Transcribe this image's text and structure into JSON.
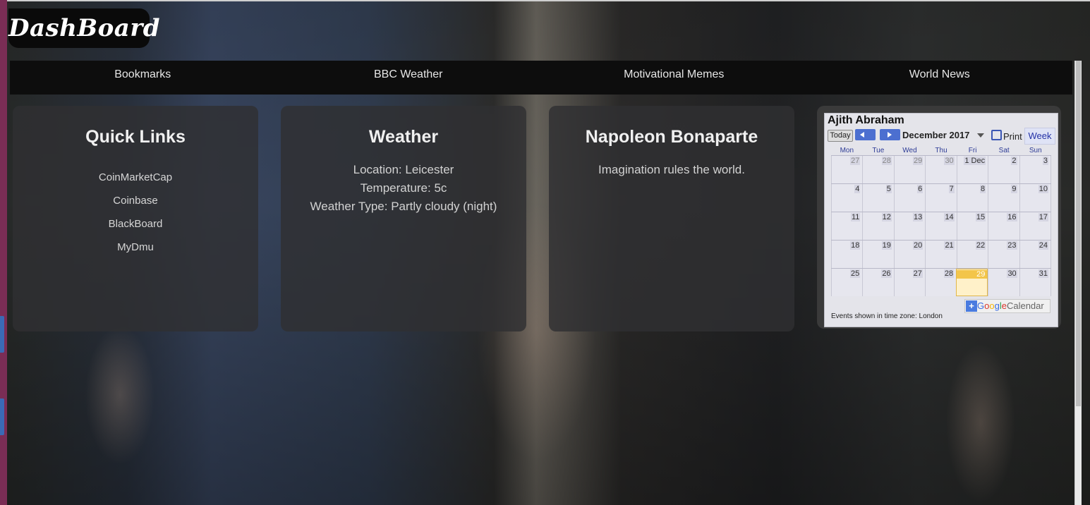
{
  "header": {
    "logo_text": "DashBoard"
  },
  "nav": {
    "items": [
      "Bookmarks",
      "BBC Weather",
      "Motivational Memes",
      "World News"
    ]
  },
  "quick_links": {
    "title": "Quick Links",
    "links": [
      "CoinMarketCap",
      "Coinbase",
      "BlackBoard",
      "MyDmu"
    ]
  },
  "weather": {
    "title": "Weather",
    "location": "Location: Leicester",
    "temperature": "Temperature: 5c",
    "type": "Weather Type: Partly cloudy (night)"
  },
  "quote": {
    "author": "Napoleon Bonaparte",
    "text": "Imagination rules the world."
  },
  "calendar": {
    "owner": "Ajith Abraham",
    "today_label": "Today",
    "month": "December 2017",
    "print_label": "Print",
    "week_label": "Week",
    "days_of_week": [
      "Mon",
      "Tue",
      "Wed",
      "Thu",
      "Fri",
      "Sat",
      "Sun"
    ],
    "weeks": [
      [
        "27",
        "28",
        "29",
        "30",
        "1 Dec",
        "2",
        "3"
      ],
      [
        "4",
        "5",
        "6",
        "7",
        "8",
        "9",
        "10"
      ],
      [
        "11",
        "12",
        "13",
        "14",
        "15",
        "16",
        "17"
      ],
      [
        "18",
        "19",
        "20",
        "21",
        "22",
        "23",
        "24"
      ],
      [
        "25",
        "26",
        "27",
        "28",
        "29",
        "30",
        "31"
      ]
    ],
    "today_date": "29",
    "timezone_text": "Events shown in time zone: London",
    "gcal_label": {
      "plus": "+",
      "brand": [
        "G",
        "o",
        "o",
        "g",
        "l",
        "e"
      ],
      "suffix": "Calendar"
    }
  },
  "colors": {
    "navbar_bg": "#0d0d0d",
    "card_bg": "#303032",
    "logo_bg": "#0a0a0a",
    "calendar_today": "#f3c54a"
  }
}
